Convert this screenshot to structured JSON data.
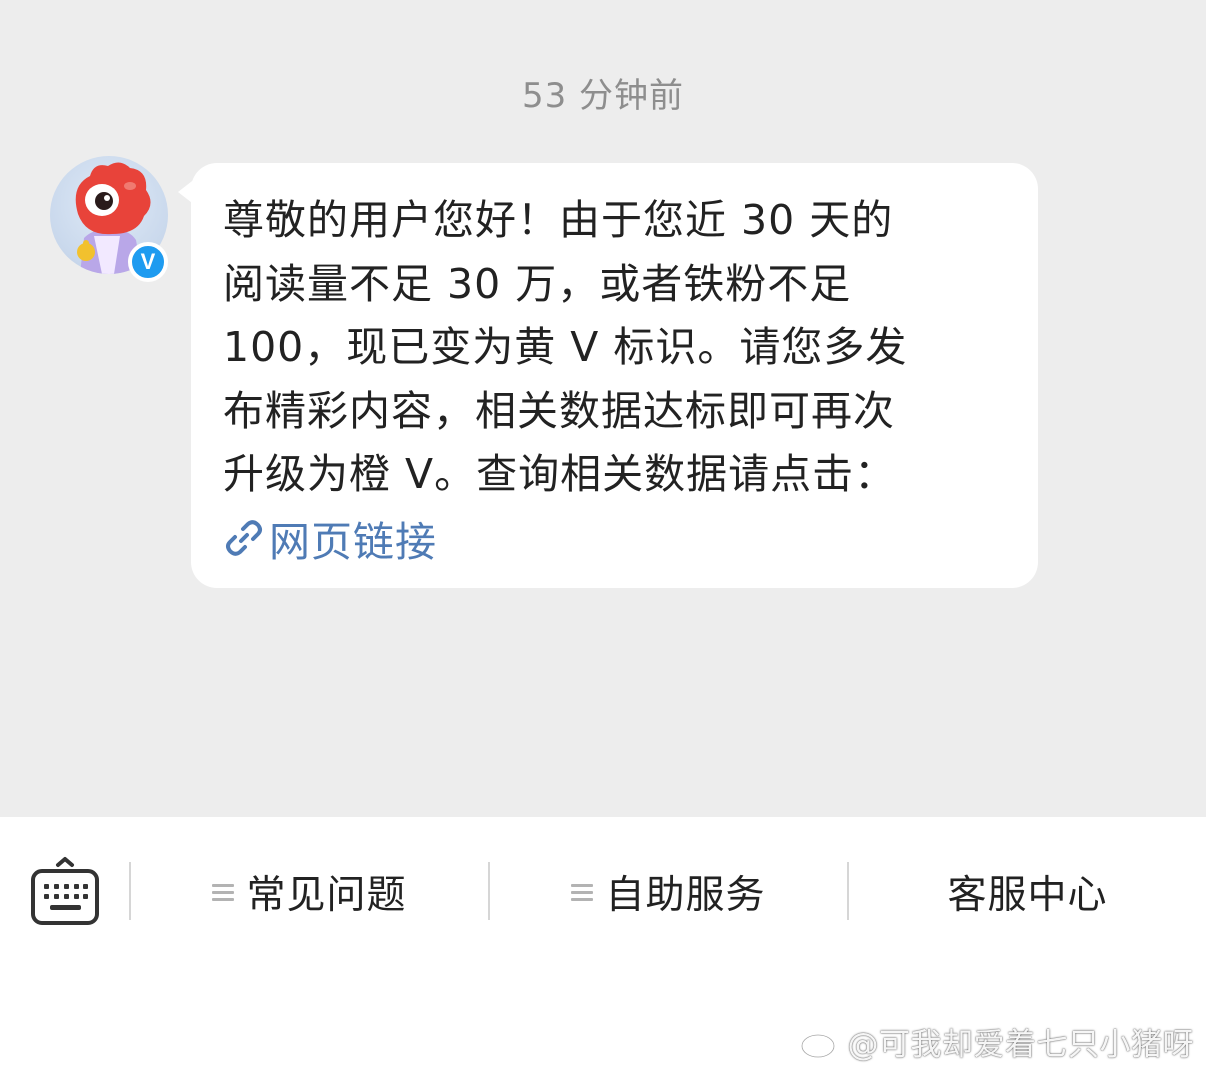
{
  "timestamp": "53 分钟前",
  "message": {
    "text_lines": [
      "尊敬的用户您好！由于您近 30 天的",
      "阅读量不足 30 万，或者铁粉不足",
      "100，现已变为黄 V 标识。请您多发",
      "布精彩内容，相关数据达标即可再次",
      "升级为橙 V。查询相关数据请点击："
    ],
    "link_label": "网页链接",
    "sender_badge": "V"
  },
  "bottom_menu": {
    "items": [
      {
        "label": "常见问题",
        "has_menu_icon": true
      },
      {
        "label": "自助服务",
        "has_menu_icon": true
      },
      {
        "label": "客服中心",
        "has_menu_icon": false
      }
    ]
  },
  "watermark": {
    "text": "@可我却爱着七只小猪呀"
  },
  "colors": {
    "background": "#ededed",
    "bubble": "#ffffff",
    "link": "#4f7bb5",
    "verified": "#1e9bf0",
    "avatar_red": "#e8433a"
  }
}
